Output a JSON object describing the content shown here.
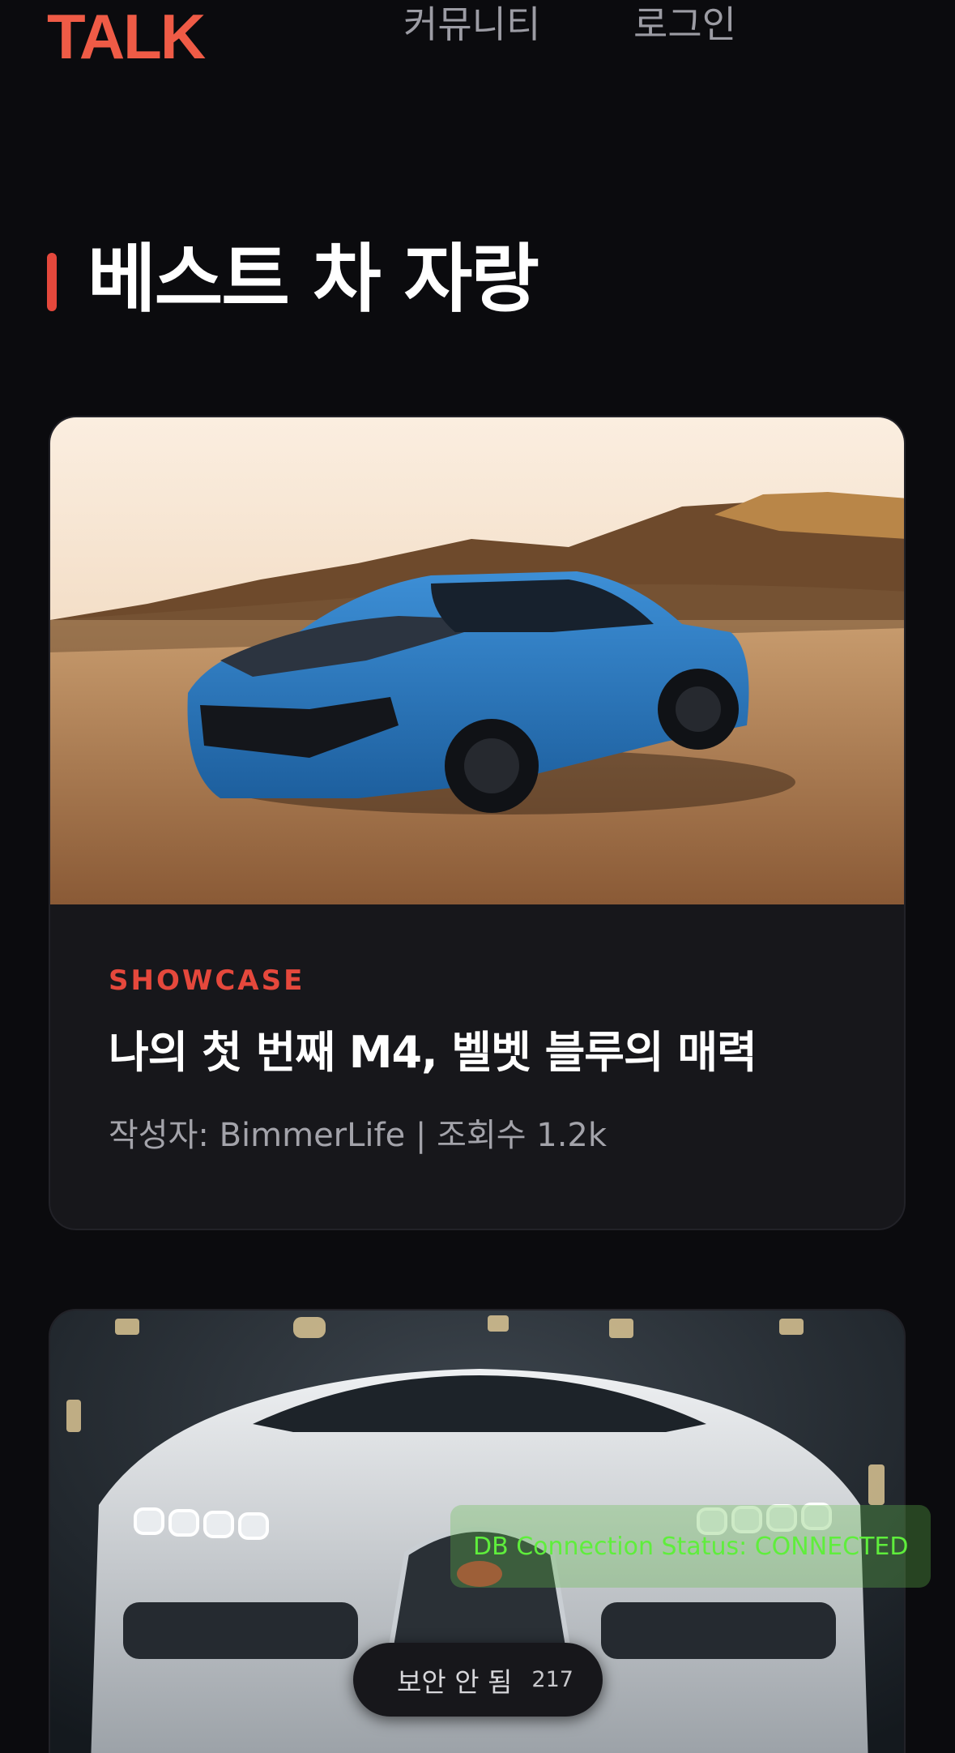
{
  "header": {
    "logo": "TALK",
    "nav": [
      {
        "label": "커뮤니티"
      },
      {
        "label": "로그인"
      }
    ]
  },
  "section": {
    "title": "베스트 차 자랑"
  },
  "cards": [
    {
      "category": "SHOWCASE",
      "title": "나의 첫 번째 M4, 벨벳 블루의 매력",
      "meta": "작성자: BimmerLife | 조회수 1.2k",
      "image": "blue sports coupe parked on desert gravel at sunset"
    },
    {
      "image": "white hypercar front view at night"
    }
  ],
  "overlays": {
    "db_status": "DB Connection Status: CONNECTED",
    "security_label": "보안 안 됨",
    "security_count": "217"
  },
  "colors": {
    "brand": "#ef5b46",
    "accent": "#e5483c",
    "background": "#0b0b0e",
    "card": "#17171b",
    "status_green": "#5fee3c"
  }
}
